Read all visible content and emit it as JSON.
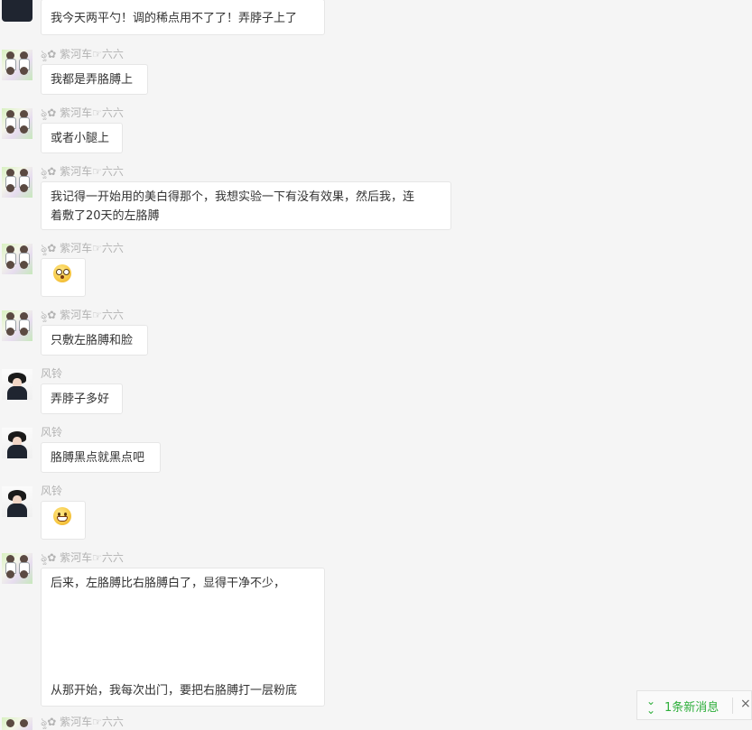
{
  "contacts": {
    "zihe": "ৡ✿ 紫河车☞六六",
    "fengling": "风铃"
  },
  "messages": [
    {
      "id": "m0",
      "sender": "",
      "lines": [
        "我今天两平勺！调的稀点用不了了！弄脖子上了"
      ]
    },
    {
      "id": "m1",
      "sender": "ৡ✿ 紫河车☞六六",
      "lines": [
        "我都是弄胳膊上"
      ]
    },
    {
      "id": "m2",
      "sender": "ৡ✿ 紫河车☞六六",
      "lines": [
        "或者小腿上"
      ]
    },
    {
      "id": "m3",
      "sender": "ৡ✿ 紫河车☞六六",
      "lines": [
        "我记得一开始用的美白得那个，我想实验一下有没有效果，然后我，连",
        "着敷了20天的左胳膊"
      ]
    },
    {
      "id": "m4",
      "sender": "ৡ✿ 紫河车☞六六",
      "emoji": "surprised-emoji"
    },
    {
      "id": "m5",
      "sender": "ৡ✿ 紫河车☞六六",
      "lines": [
        "只敷左胳膊和脸"
      ]
    },
    {
      "id": "m6",
      "sender": "风铃",
      "lines": [
        "弄脖子多好"
      ]
    },
    {
      "id": "m7",
      "sender": "风铃",
      "lines": [
        "胳膊黑点就黑点吧"
      ]
    },
    {
      "id": "m8",
      "sender": "风铃",
      "emoji": "grin-emoji"
    },
    {
      "id": "m9",
      "sender": "ৡ✿ 紫河车☞六六",
      "lines": [
        "后来，左胳膊比右胳膊白了，显得干净不少，",
        "从那开始，我每次出门，要把右胳膊打一层粉底"
      ]
    },
    {
      "id": "m10",
      "sender": "ৡ✿ 紫河车☞六六"
    }
  ],
  "new_message_bar": {
    "label": "1条新消息",
    "chevron_icon": "double-chevron-down-icon",
    "close_label": "×"
  },
  "colors": {
    "background": "#f5f5f5",
    "bubble": "#ffffff",
    "nickname": "#b3b3b3",
    "accent_green": "#2dae3a"
  }
}
